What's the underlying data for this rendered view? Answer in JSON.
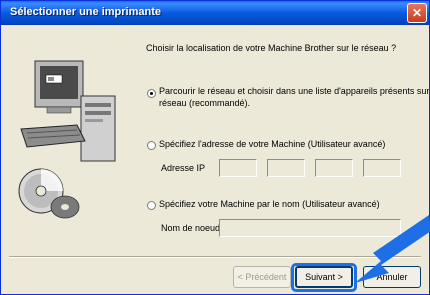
{
  "window": {
    "title": "Sélectionner une imprimante",
    "close_glyph": "✕"
  },
  "intro": "Choisir la localisation de votre Machine Brother sur le réseau ?",
  "options": {
    "browse": {
      "line1": "Parcourir le réseau et choisir dans une liste d'appareils présents sur le",
      "line2": "réseau (recommandé).",
      "selected": true
    },
    "ip": {
      "label": "Spécifiez l'adresse de votre Machine (Utilisateur avancé)",
      "field_label": "Adresse IP",
      "octets": [
        "",
        "",
        "",
        ""
      ],
      "selected": false
    },
    "name": {
      "label": "Spécifiez votre Machine par le nom (Utilisateur avancé)",
      "field_label": "Nom de noeud",
      "value": "",
      "selected": false
    }
  },
  "buttons": {
    "back": "< Précédent",
    "next": "Suivant >",
    "cancel": "Annuler"
  },
  "colors": {
    "titlebar": "#0a5be0",
    "highlight": "#1e6ee6"
  },
  "icons": [
    "computer-icon",
    "cd-disc-icon",
    "pointer-arrow-icon"
  ]
}
